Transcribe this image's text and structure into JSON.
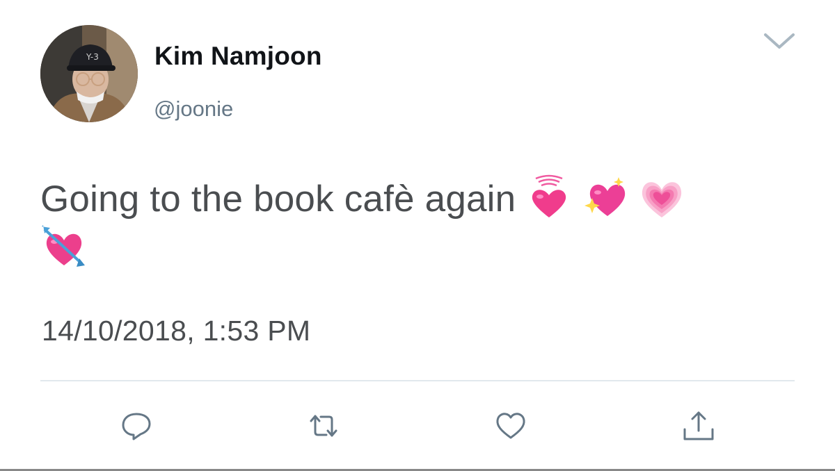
{
  "user": {
    "display_name": "Kim Namjoon",
    "handle": "@joonie",
    "avatar_icon": "profile-photo"
  },
  "tweet": {
    "text_line1": "Going to the book cafè again",
    "emojis": [
      "vibrating-heart",
      "sparkling-heart",
      "growing-heart",
      "heart-with-arrow"
    ],
    "timestamp": "14/10/2018, 1:53 PM"
  },
  "actions": {
    "reply_icon": "reply-icon",
    "retweet_icon": "retweet-icon",
    "like_icon": "heart-outline-icon",
    "share_icon": "share-icon"
  },
  "colors": {
    "text": "#4a4d50",
    "secondary": "#657786",
    "icon": "#657786",
    "divider": "#e1e8ed",
    "heart": "#f03c8c"
  }
}
